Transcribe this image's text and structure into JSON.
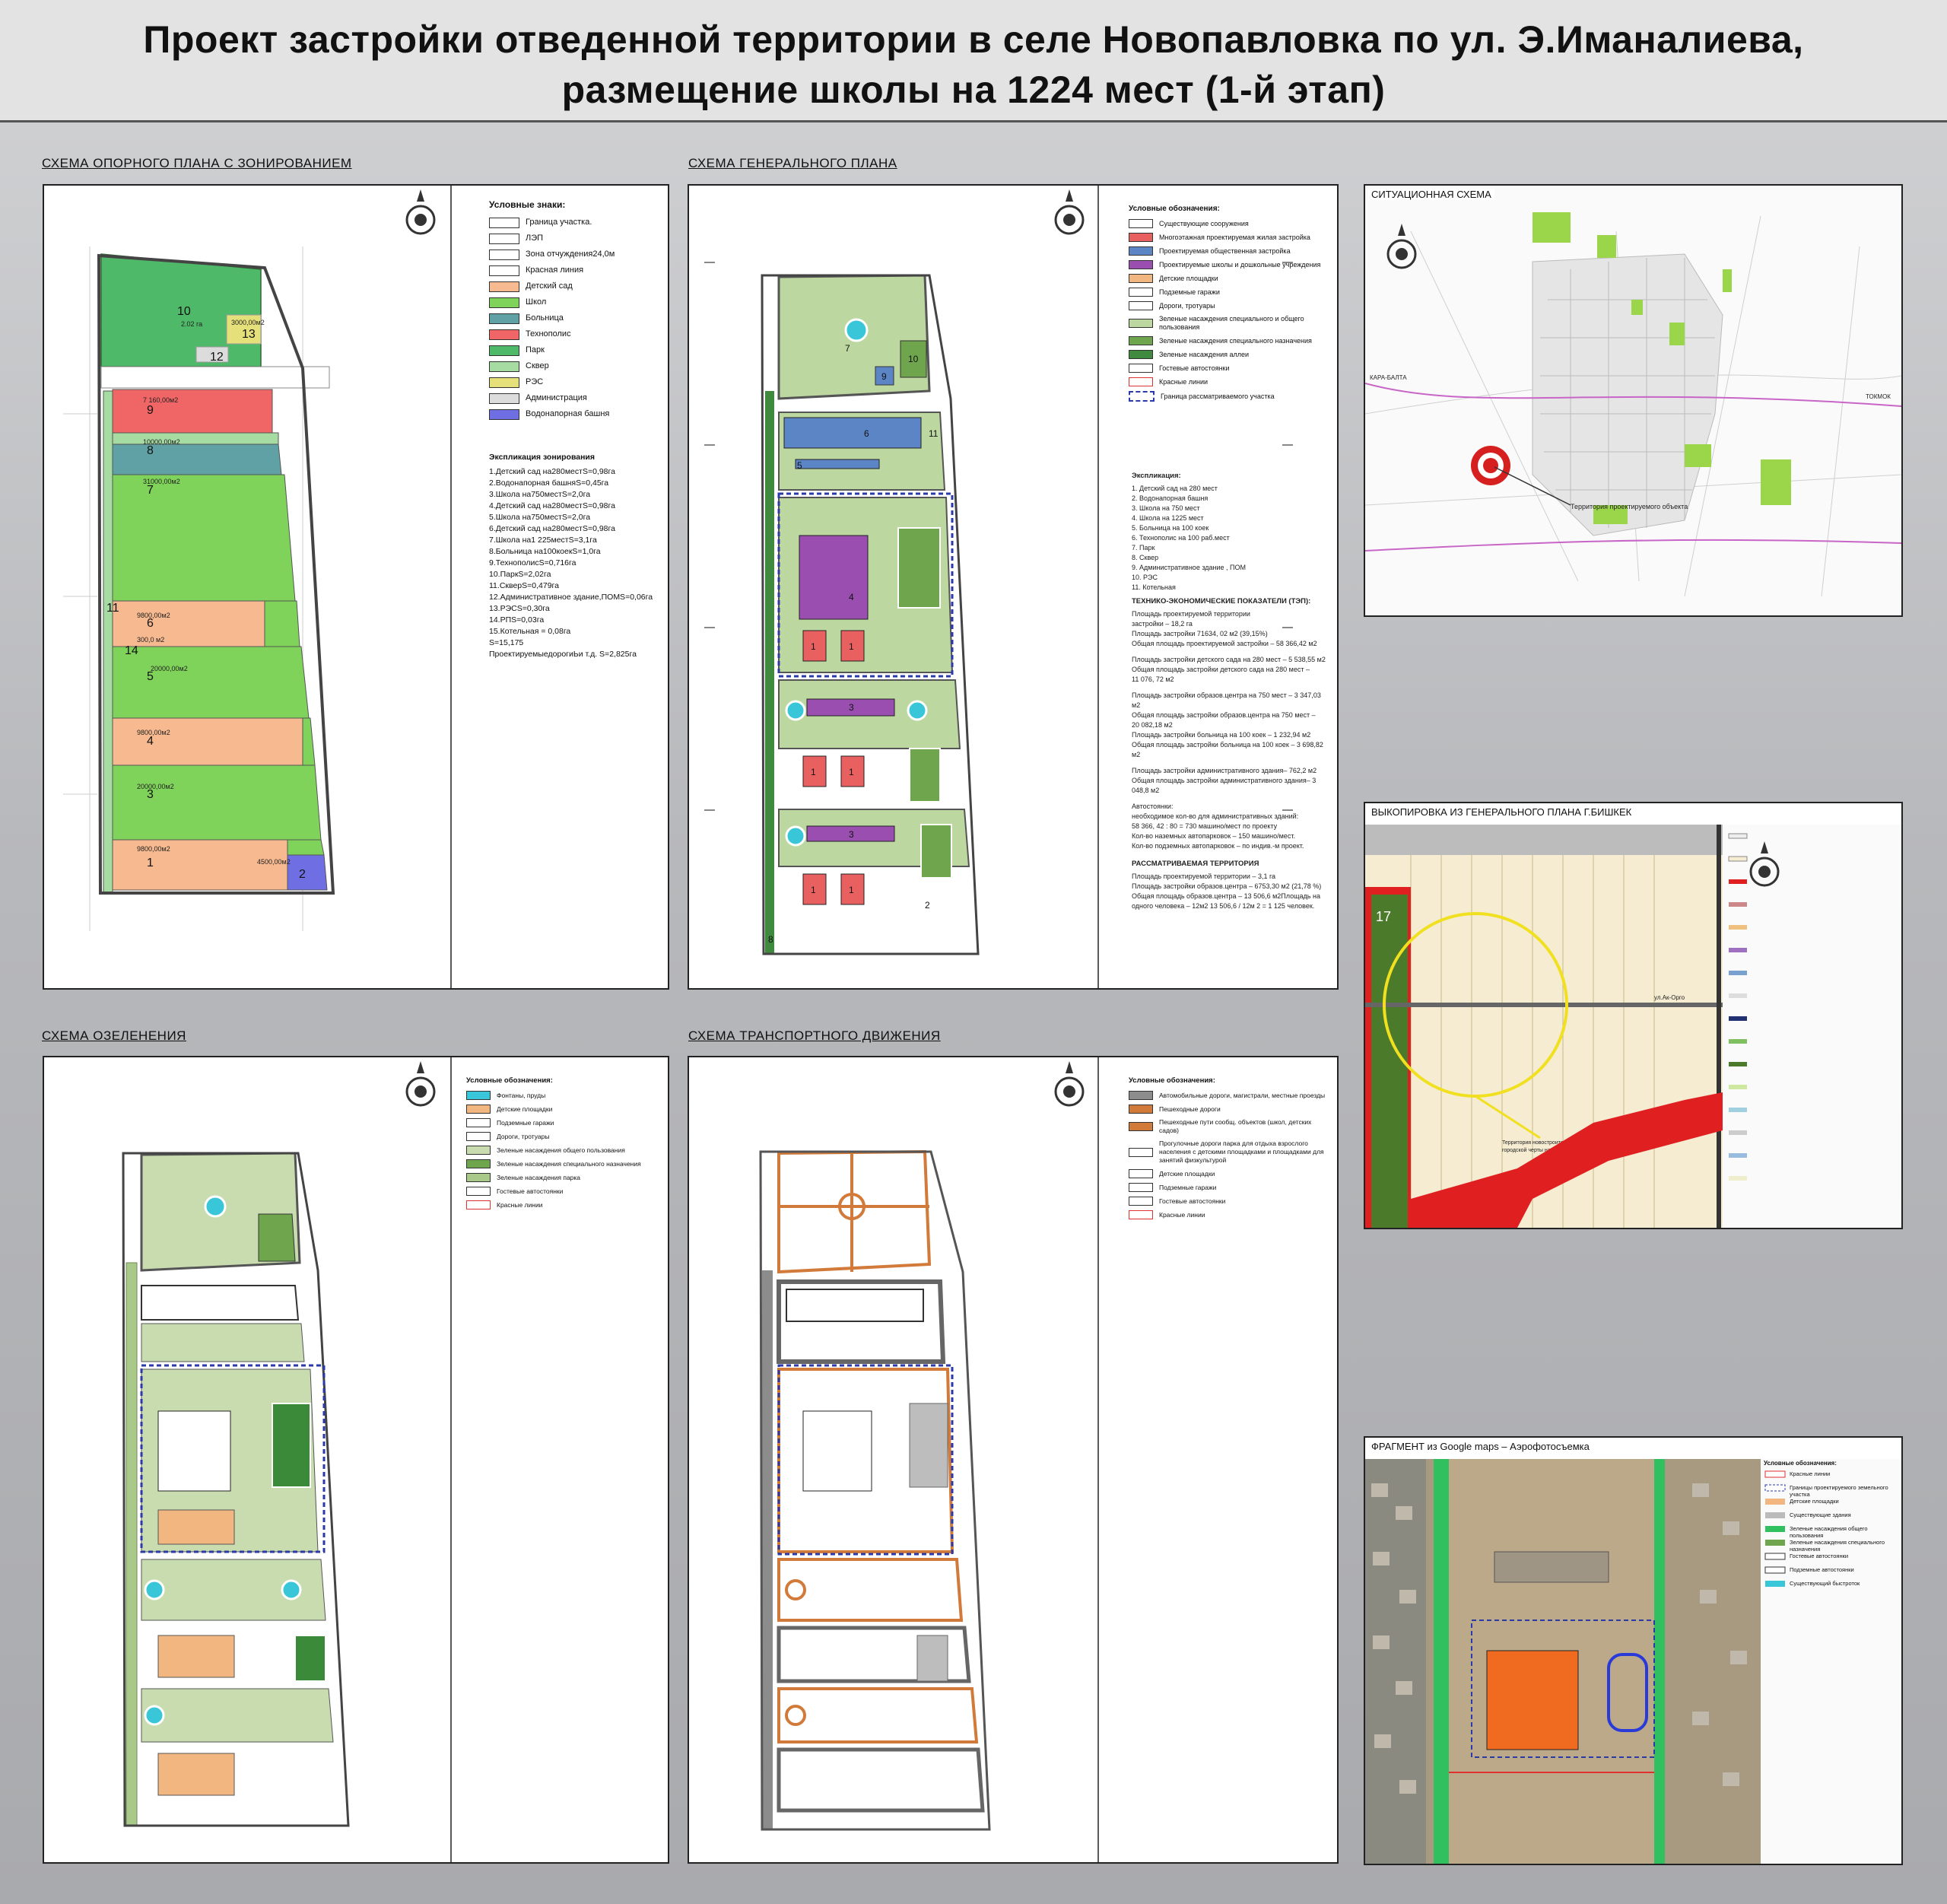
{
  "header": {
    "title_line1": "Проект застройки отведенной территории в селе Новопавловка по ул. Э.Иманалиева,",
    "title_line2": "размещение школы на 1224 мест (1-й этап)"
  },
  "sections": {
    "zoning": "СХЕМА ОПОРНОГО ПЛАНА С ЗОНИРОВАНИЕМ",
    "master": "СХЕМА ГЕНЕРАЛЬНОГО ПЛАНА",
    "green": "СХЕМА ОЗЕЛЕНЕНИЯ",
    "transport": "СХЕМА ТРАНСПОРТНОГО ДВИЖЕНИЯ",
    "situation": "СИТУАЦИОННАЯ СХЕМА",
    "extract": "ВЫКОПИРОВКА ИЗ ГЕНЕРАЛЬНОГО ПЛАНА Г.БИШКЕК",
    "aerial": "ФРАГМЕНТ из Google maps – Аэрофотосъемка"
  },
  "zoning_legend": {
    "title": "Условные знаки:",
    "items": [
      {
        "label": "Граница участка.",
        "color": "#ffffff"
      },
      {
        "label": "ЛЭП",
        "color": "#ffffff"
      },
      {
        "label": "Зона отчуждения24,0м",
        "color": "#ffffff"
      },
      {
        "label": "Красная линия",
        "color": "#ffffff"
      },
      {
        "label": "Детский сад",
        "color": "#f7b98f"
      },
      {
        "label": "Школ",
        "color": "#7fd35a"
      },
      {
        "label": "Больница",
        "color": "#5fa1a5"
      },
      {
        "label": "Технополис",
        "color": "#f06565"
      },
      {
        "label": "Парк",
        "color": "#4fb96a"
      },
      {
        "label": "Сквер",
        "color": "#a6dca2"
      },
      {
        "label": "РЭС",
        "color": "#e6e07a"
      },
      {
        "label": "Администрация",
        "color": "#dcdcdc"
      },
      {
        "label": "Водонапорная башня",
        "color": "#6f6fe3"
      }
    ]
  },
  "zoning_explication": {
    "title": "Экспликация зонирования",
    "items": [
      "1.Детский сад на280местS=0,98га",
      "2.Водонапорная башняS=0,45га",
      "3.Школа на750местS=2,0га",
      "4.Детский сад на280местS=0,98га",
      "5.Школа на750местS=2,0га",
      "6.Детский сад на280местS=0,98га",
      "7.Школа на1 225местS=3,1га",
      "8.Больница на100коекS=1,0га",
      "9.ТехнополисS=0,716га",
      "10.ПаркS=2,02га",
      "11.СкверS=0,479га",
      "12.Административное здание,ПОМS=0,06га",
      "13.РЭСS=0,30га",
      "14.РПS=0,03га",
      "15.Котельная = 0,08га",
      "S=15,175",
      "ПроектируемыедорогиЬи т.д. S=2,825га"
    ]
  },
  "zoning_map": {
    "zone_labels": [
      "10",
      "13",
      "12",
      "9",
      "8",
      "7",
      "6",
      "14",
      "5",
      "4",
      "3",
      "1",
      "2",
      "11"
    ],
    "area_labels": [
      "2.02 га",
      "3000,00м2",
      "7 160,00м2",
      "10000,00м2",
      "31000,00м2",
      "9800,00м2",
      "300,0 м2",
      "20000,00м2",
      "9800,00м2",
      "20000,00м2",
      "9800,00м2",
      "4500,00м2"
    ]
  },
  "master_legend": {
    "title": "Условные обозначения:",
    "items": [
      {
        "label": "Существующие сооружения",
        "color": "#ffffff"
      },
      {
        "label": "Многоэтажная проектируемая жилая застройка",
        "color": "#e86060"
      },
      {
        "label": "Проектируемая общественная застройка",
        "color": "#5c85c5"
      },
      {
        "label": "Проектируемые школы и дошкольные учреждения",
        "color": "#9a4fb0"
      },
      {
        "label": "Детские площадки",
        "color": "#f2b780"
      },
      {
        "label": "Подземные гаражи",
        "color": "#ffffff"
      },
      {
        "label": "Дороги, тротуары",
        "color": "#ffffff"
      },
      {
        "label": "Зеленые насаждения специального и общего пользования",
        "color": "#bcd7a0"
      },
      {
        "label": "Зеленые насаждения специального назначения",
        "color": "#6fa54c"
      },
      {
        "label": "Зеленые насаждения аллеи",
        "color": "#3f8a3f"
      },
      {
        "label": "Гостевые автостоянки",
        "color": "#ffffff"
      },
      {
        "label": "Красные линии",
        "color": "#ffffff"
      },
      {
        "label": "Граница рассматриваемого участка",
        "color": "#ffffff"
      }
    ]
  },
  "master_explication": {
    "title": "Экспликация:",
    "items": [
      "1. Детский сад на 280 мест",
      "2. Водонапорная башня",
      "3. Школа на 750 мест",
      "4. Школа на 1225 мест",
      "5. Больница на 100 коек",
      "6. Технополис на 100 раб.мест",
      "7. Парк",
      "8. Сквер",
      "9. Административное здание , ПОМ",
      "10. РЭС",
      "11. Котельная"
    ]
  },
  "master_tep": {
    "title": "ТЕХНИКО-ЭКОНОМИЧЕСКИЕ ПОКАЗАТЕЛИ (ТЭП):",
    "lines": [
      "Площадь проектируемой территории",
      "застройки – 18,2 га",
      "Площадь застройки 71634, 02 м2 (39,15%)",
      "Общая площадь проектируемой застройки – 58 366,42 м2",
      "",
      "Площадь застройки детского сада на 280 мест – 5 538,55 м2",
      "Общая площадь застройки детского сада на 280 мест –",
      "11 076, 72 м2",
      "",
      "Площадь застройки образов.центра на 750 мест – 3 347,03 м2",
      "Общая площадь застройки образов.центра на 750 мест –",
      "20 082,18 м2",
      "Площадь застройки больница на 100 коек – 1 232,94 м2",
      "Общая площадь застройки больница на 100 коек – 3 698,82 м2",
      "",
      "Площадь застройки административного здания– 762,2 м2",
      "Общая площадь застройки административного здания– 3",
      "048,8 м2",
      "",
      "Автостоянки:",
      "необходимое кол-во для административных зданий:",
      "58 366, 42 : 80 = 730 машино/мест по проекту",
      "Кол-во наземных автопарковок – 150 машино/мест.",
      "Кол-во подземных автопарковок – по индив.-м проект."
    ],
    "sub_title": "РАССМАТРИВАЕМАЯ ТЕРРИТОРИЯ",
    "sub_lines": [
      "Площадь проектируемой территории – 3,1 га",
      "Площадь застройки образов.центра – 6753,30 м2 (21,78 %)",
      "Общая площадь образов.центра – 13 506,6 м2Площадь на",
      "одного человека – 12м2 13 506,6 / 12м 2 = 1 125 человек."
    ]
  },
  "master_map": {
    "numbers": [
      "7",
      "10",
      "9",
      "6",
      "11",
      "5",
      "4",
      "1",
      "1",
      "3",
      "1",
      "1",
      "3",
      "1",
      "1",
      "8",
      "2"
    ]
  },
  "green_legend": {
    "title": "Условные обозначения:",
    "items": [
      {
        "label": "Фонтаны, пруды",
        "color": "#39c6d8"
      },
      {
        "label": "Детские площадки",
        "color": "#f2b780"
      },
      {
        "label": "Подземные гаражи",
        "color": "#ffffff"
      },
      {
        "label": "Дороги, тротуары",
        "color": "#ffffff"
      },
      {
        "label": "Зеленые насаждения общего пользования",
        "color": "#c8dcb0"
      },
      {
        "label": "Зеленые насаждения специального назначения",
        "color": "#6fa54c"
      },
      {
        "label": "Зеленые насаждения парка",
        "color": "#a9c98a"
      },
      {
        "label": "Гостевые автостоянки",
        "color": "#ffffff"
      },
      {
        "label": "Красные линии",
        "color": "#ffffff"
      }
    ]
  },
  "transport_legend": {
    "title": "Условные обозначения:",
    "items": [
      {
        "label": "Автомобильные дороги, магистрали, местные проезды",
        "color": "#8c8c8c"
      },
      {
        "label": "Пешеходные дороги",
        "color": "#d27a3a"
      },
      {
        "label": "Пешеходные пути сообщ. объектов (школ, детских садов)",
        "color": "#d27a3a"
      },
      {
        "label": "Прогулочные дороги парка для отдыха взрослого населения с детскими площадками и площадками для занятий физкультурой",
        "color": "#ffffff"
      },
      {
        "label": "Детские площадки",
        "color": "#ffffff"
      },
      {
        "label": "Подземные гаражи",
        "color": "#ffffff"
      },
      {
        "label": "Гостевые автостоянки",
        "color": "#ffffff"
      },
      {
        "label": "Красные линии",
        "color": "#ffffff"
      }
    ]
  },
  "situation": {
    "place_labels": [
      "КАРА-БАЛТА",
      "ТОКМОК"
    ],
    "pointer": "Территория проектируемого объекта"
  },
  "extract": {
    "zone_number": "17",
    "road": "ул.Ак-Орго",
    "note_line1": "Территория новостроительства, за пределами",
    "note_line2": "городской черты на расчетный срок"
  },
  "aerial": {
    "legend_title": "Условные обозначения:",
    "items": [
      "Красные линии",
      "Границы проектируемого земельного участка",
      "Детские площадки",
      "Существующие здания",
      "Зеленые насаждения общего пользования",
      "Зеленые насаждения специального назначения",
      "Гостевые автостоянки",
      "Подземные автостоянки",
      "Существующий быстроток"
    ]
  },
  "colors": {
    "board": "#b7b8bb",
    "kindergarten": "#f7b98f",
    "school": "#7fd35a",
    "hospital": "#5fa1a5",
    "technopolis": "#f06565",
    "park": "#4fb96a",
    "square": "#a6dca2",
    "res": "#e6e07a",
    "water_tower": "#6f6fe3"
  }
}
